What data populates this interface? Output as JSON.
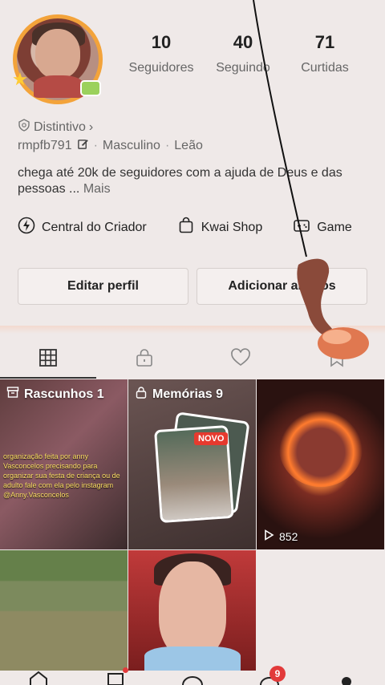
{
  "profile": {
    "stats": [
      {
        "value": "10",
        "label": "Seguidores"
      },
      {
        "value": "40",
        "label": "Seguindo"
      },
      {
        "value": "71",
        "label": "Curtidas"
      }
    ],
    "badge_label": "Distintivo",
    "username": "rmpfb791",
    "gender": "Masculino",
    "sign": "Leão",
    "bio": "chega até 20k de seguidores com a ajuda  de Deus e das pessoas  ...",
    "bio_more": "Mais"
  },
  "tools": {
    "creator_center": "Central do Criador",
    "kwai_shop": "Kwai Shop",
    "game": "Game"
  },
  "actions": {
    "edit_profile": "Editar perfil",
    "add_friends": "Adicionar amigos"
  },
  "tabs": {
    "icons": [
      "grid-icon",
      "lock-icon",
      "heart-icon",
      "bookmark-icon"
    ]
  },
  "grid": {
    "drafts_label": "Rascunhos 1",
    "memories_label": "Memórias 9",
    "new_badge": "NOVO",
    "video_views": "852",
    "caption": "organização feita por anny Vasconcelos precisando para organizar sua festa de criança ou de adulto fale com ela pelo instagram @Anny.Vasconcelos"
  },
  "nav": {
    "messages_badge": "9"
  },
  "colors": {
    "background": "#efe9e8",
    "accent_red": "#e23a3a",
    "avatar_ring": "#f3a33a"
  }
}
